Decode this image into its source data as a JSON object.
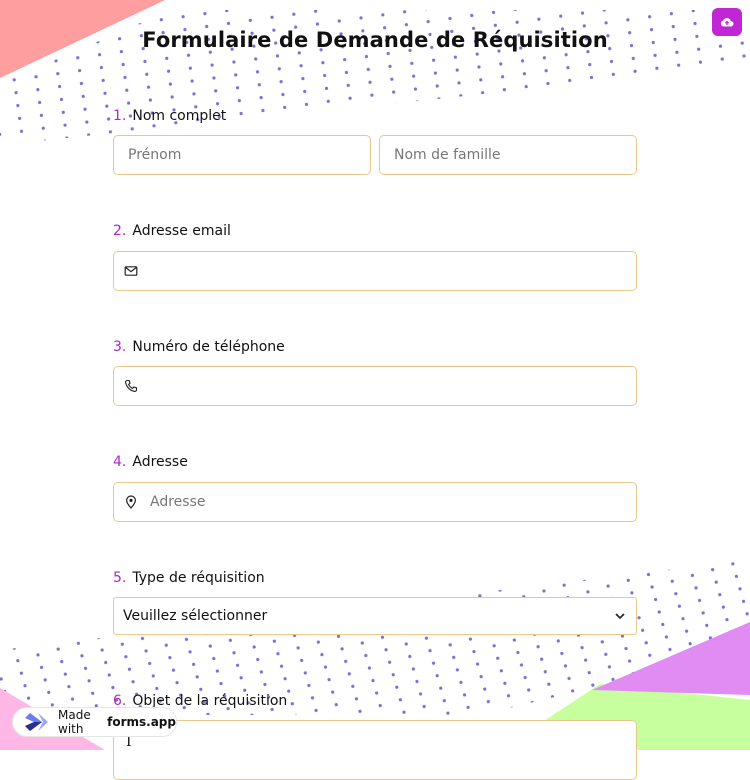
{
  "form": {
    "title": "Formulaire de Demande de Réquisition"
  },
  "questions": [
    {
      "number": "1.",
      "label": "Nom complet",
      "first_name_placeholder": "Prénom",
      "last_name_placeholder": "Nom de famille"
    },
    {
      "number": "2.",
      "label": "Adresse email",
      "icon": "envelope-icon",
      "value": ""
    },
    {
      "number": "3.",
      "label": "Numéro de téléphone",
      "icon": "phone-icon",
      "value": ""
    },
    {
      "number": "4.",
      "label": "Adresse",
      "icon": "location-pin-icon",
      "placeholder": "Adresse"
    },
    {
      "number": "5.",
      "label": "Type de réquisition",
      "selected": "Veuillez sélectionner"
    },
    {
      "number": "6.",
      "label": "Objet de la réquisition",
      "value": "I"
    }
  ],
  "toolbar": {
    "upload_icon": "cloud-upload-icon"
  },
  "footer": {
    "made_with": "Made with",
    "brand": "forms.app"
  },
  "colors": {
    "accent": "#c026d3",
    "number": "#b026c8",
    "border": "#e9c98b",
    "dots": "#7b6fd6",
    "corner_top": "#ff9e9e",
    "corner_bottom_pink": "#ffb8e6",
    "corner_bottom_green": "#c7ff9e",
    "corner_bottom_violet": "#e18cf2"
  }
}
